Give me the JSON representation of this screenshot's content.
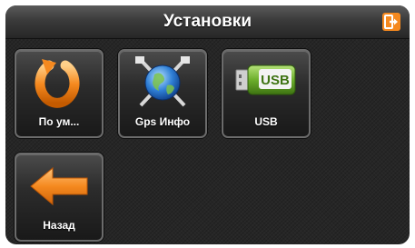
{
  "header": {
    "title": "Установки",
    "exit_icon": "exit-icon"
  },
  "tiles": [
    {
      "label": "По ум...",
      "icon": "reset-default-icon"
    },
    {
      "label": "Gps Инфо",
      "icon": "gps-satellite-globe-icon"
    },
    {
      "label": "USB",
      "icon": "usb-flash-drive-icon",
      "icon_text": "USB"
    },
    {
      "label": "Назад",
      "icon": "back-arrow-icon"
    }
  ],
  "colors": {
    "accent_orange": "#f5891f",
    "header_text": "#ffffff",
    "usb_green": "#6cae2c"
  }
}
